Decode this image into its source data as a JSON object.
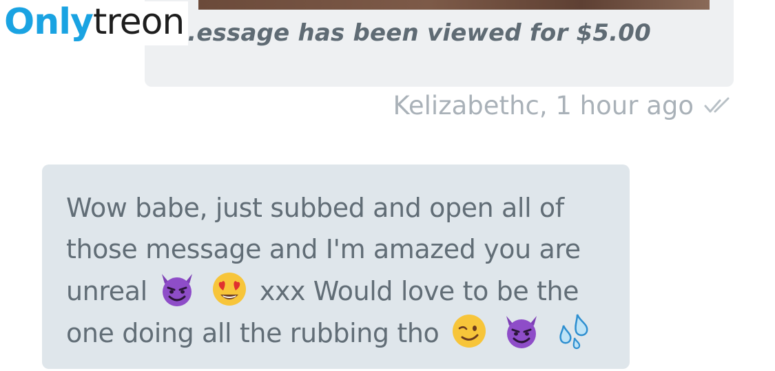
{
  "brand": {
    "logo_part1": "Only",
    "logo_part2": "treon"
  },
  "sent_message": {
    "text": "...essage has been viewed for $5.00",
    "sender": "Kelizabethc",
    "time": "1 hour ago",
    "meta_text": "Kelizabethc, 1 hour ago",
    "status_icon": "double-check-icon"
  },
  "received_message": {
    "line1": "Wow babe, just subbed and open all of",
    "line2": "those message and I'm amazed you are",
    "line3_start": "unreal",
    "line3_end": "xxx Would love to be the",
    "line4_start": "one doing all the rubbing tho",
    "emojis": [
      "smiling-devil-emoji",
      "heart-eyes-emoji",
      "smiling-devil-emoji",
      "winking-emoji",
      "smiling-devil-emoji",
      "sweat-droplets-emoji"
    ]
  },
  "colors": {
    "logo_blue": "#1aa3e2",
    "sent_bubble": "#eef0f2",
    "received_bubble": "#dfe6eb",
    "text": "#616d76",
    "meta_text": "#a9b1b8"
  }
}
